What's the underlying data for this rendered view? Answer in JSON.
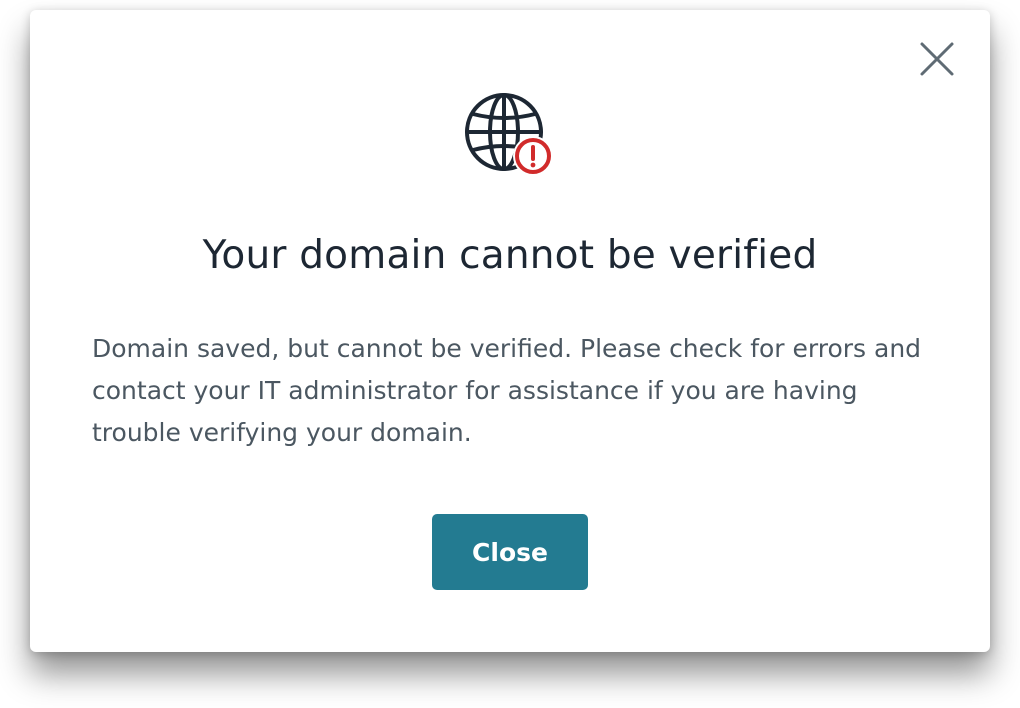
{
  "dialog": {
    "title": "Your domain cannot be verified",
    "message": "Domain saved, but cannot be verified. Please check for errors and contact your IT administrator for assistance if you are having trouble verifying your domain.",
    "close_button_label": "Close",
    "icons": {
      "dismiss": "close-icon",
      "hero": "globe-warning-icon"
    }
  },
  "colors": {
    "title_text": "#1d2733",
    "body_text": "#4b5761",
    "primary_button": "#237b91",
    "warning": "#d12b2b",
    "icon_stroke": "#1d2733",
    "close_icon": "#5f6b74"
  }
}
